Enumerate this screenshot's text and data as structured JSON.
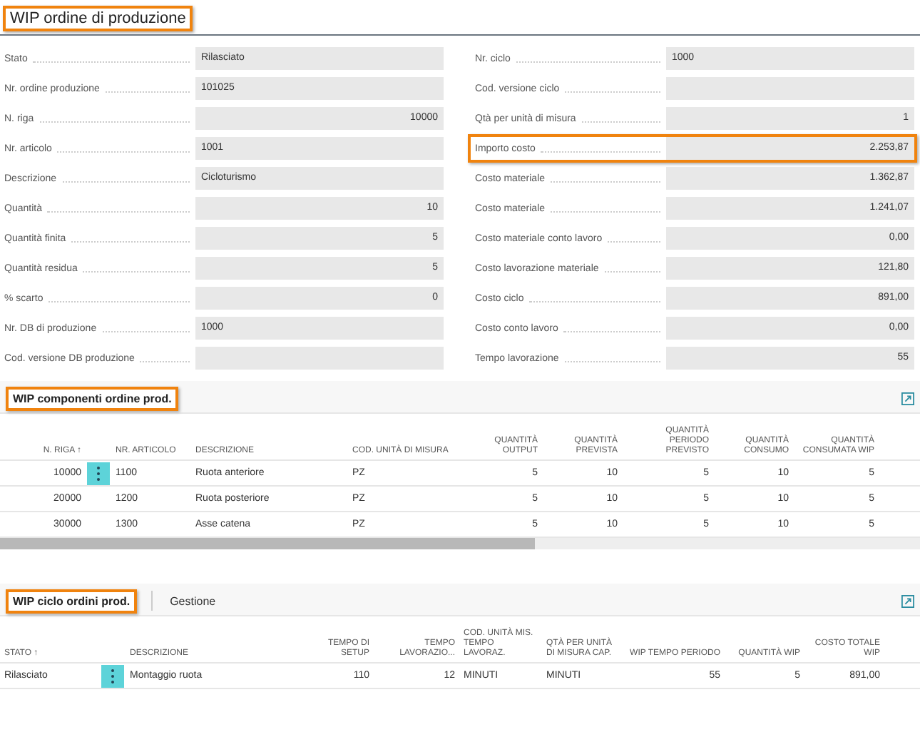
{
  "header": {
    "title": "WIP ordine di produzione",
    "highlighted": true
  },
  "fields_left": [
    {
      "label": "Stato",
      "value": "Rilasciato",
      "kind": "text",
      "highlighted": false
    },
    {
      "label": "Nr. ordine produzione",
      "value": "101025",
      "kind": "text",
      "highlighted": false
    },
    {
      "label": "N. riga",
      "value": "10000",
      "kind": "number",
      "highlighted": false
    },
    {
      "label": "Nr. articolo",
      "value": "1001",
      "kind": "text",
      "highlighted": false
    },
    {
      "label": "Descrizione",
      "value": "Cicloturismo",
      "kind": "text",
      "highlighted": false
    },
    {
      "label": "Quantità",
      "value": "10",
      "kind": "number",
      "highlighted": false
    },
    {
      "label": "Quantità finita",
      "value": "5",
      "kind": "number",
      "highlighted": false
    },
    {
      "label": "Quantità residua",
      "value": "5",
      "kind": "number",
      "highlighted": false
    },
    {
      "label": "% scarto",
      "value": "0",
      "kind": "number",
      "highlighted": false
    },
    {
      "label": "Nr. DB di produzione",
      "value": "1000",
      "kind": "text",
      "highlighted": false
    },
    {
      "label": "Cod. versione DB produzione",
      "kind": "text",
      "highlighted": false
    }
  ],
  "fields_right": [
    {
      "label": "Nr. ciclo",
      "value": "1000",
      "kind": "text",
      "highlighted": false
    },
    {
      "label": "Cod. versione ciclo",
      "kind": "text",
      "highlighted": false
    },
    {
      "label": "Qtà per unità di misura",
      "value": "1",
      "kind": "number",
      "highlighted": false
    },
    {
      "label": "Importo costo",
      "value": "2.253,87",
      "kind": "number",
      "highlighted": true
    },
    {
      "label": "Costo materiale",
      "value": "1.362,87",
      "kind": "number",
      "highlighted": false
    },
    {
      "label": "Costo materiale",
      "value": "1.241,07",
      "kind": "number",
      "highlighted": false
    },
    {
      "label": "Costo materiale conto lavoro",
      "value": "0,00",
      "kind": "number",
      "highlighted": false
    },
    {
      "label": "Costo lavorazione materiale",
      "value": "121,80",
      "kind": "number",
      "highlighted": false
    },
    {
      "label": "Costo ciclo",
      "value": "891,00",
      "kind": "number",
      "highlighted": false
    },
    {
      "label": "Costo conto lavoro",
      "value": "0,00",
      "kind": "number",
      "highlighted": false
    },
    {
      "label": "Tempo lavorazione",
      "value": "55",
      "kind": "number",
      "highlighted": false
    }
  ],
  "parts": [
    {
      "title": "WIP componenti ordine prod.",
      "highlighted": true,
      "columns": [
        {
          "label": "N. RIGA ↑",
          "kind": "number"
        },
        {
          "label": "NR. ARTICOLO",
          "kind": "text"
        },
        {
          "label": "DESCRIZIONE",
          "kind": "text"
        },
        {
          "label": "COD. UNITÀ DI MISURA",
          "kind": "text"
        },
        {
          "label": "QUANTITÀ OUTPUT",
          "kind": "number"
        },
        {
          "label": "QUANTITÀ PREVISTA",
          "kind": "number"
        },
        {
          "label": "QUANTITÀ PERIODO PREVISTO",
          "kind": "number"
        },
        {
          "label": "QUANTITÀ CONSUMO",
          "kind": "number"
        },
        {
          "label": "QUANTITÀ CONSUMATA WIP",
          "kind": "number"
        }
      ],
      "rows": [
        {
          "selected": true,
          "cells": [
            "10000",
            "1100",
            "Ruota anteriore",
            "PZ",
            "5",
            "10",
            "5",
            "10",
            "5"
          ]
        },
        {
          "selected": false,
          "cells": [
            "20000",
            "1200",
            "Ruota posteriore",
            "PZ",
            "5",
            "10",
            "5",
            "10",
            "5"
          ]
        },
        {
          "selected": false,
          "cells": [
            "30000",
            "1300",
            "Asse catena",
            "PZ",
            "5",
            "10",
            "5",
            "10",
            "5"
          ]
        }
      ]
    },
    {
      "title": "WIP ciclo ordini prod.",
      "highlighted": true,
      "action": "Gestione",
      "columns": [
        {
          "label": "STATO ↑",
          "kind": "text"
        },
        {
          "label": "DESCRIZIONE",
          "kind": "text"
        },
        {
          "label": "TEMPO DI SETUP",
          "kind": "number"
        },
        {
          "label": "TEMPO LAVORAZIO...",
          "kind": "number"
        },
        {
          "label": "COD. UNITÀ MIS. TEMPO LAVORAZ.",
          "kind": "text"
        },
        {
          "label": "QTÀ PER UNITÀ DI MISURA CAP.",
          "kind": "text"
        },
        {
          "label": "WIP TEMPO PERIODO",
          "kind": "number"
        },
        {
          "label": "QUANTITÀ WIP",
          "kind": "number"
        },
        {
          "label": "COSTO TOTALE WIP",
          "kind": "number"
        }
      ],
      "rows": [
        {
          "selected": true,
          "cells": [
            "Rilasciato",
            "Montaggio ruota",
            "110",
            "12",
            "MINUTI",
            "MINUTI",
            "55",
            "5",
            "891,00"
          ]
        }
      ]
    }
  ]
}
